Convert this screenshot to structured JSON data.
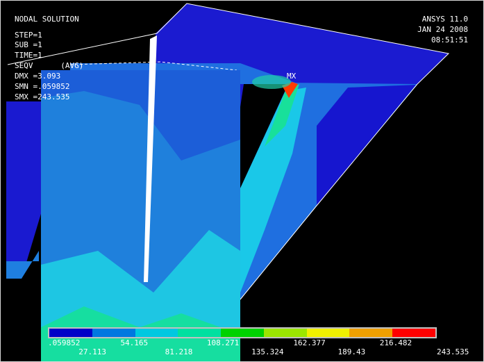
{
  "header": {
    "title": "NODAL SOLUTION",
    "step": "STEP=1",
    "sub": "SUB =1",
    "time": "TIME=1",
    "result": "SEQV      (AVG)",
    "dmx": "DMX =3.093",
    "smn": "SMN =.059852",
    "smx": "SMX =243.535"
  },
  "stamp": {
    "product": "ANSYS 11.0",
    "date": "JAN 24 2008",
    "time": "08:51:51"
  },
  "max_marker": "MX",
  "legend": {
    "colors": [
      "#0000c8",
      "#0078e0",
      "#00c8e0",
      "#00e0a0",
      "#00d200",
      "#9be600",
      "#f0f000",
      "#f0a000",
      "#ff0000"
    ],
    "top_labels": [
      ".059852",
      "54.165",
      "108.271",
      "162.377",
      "216.482"
    ],
    "bottom_labels": [
      "27.113",
      "81.218",
      "135.324",
      "189.43",
      "243.535"
    ]
  }
}
